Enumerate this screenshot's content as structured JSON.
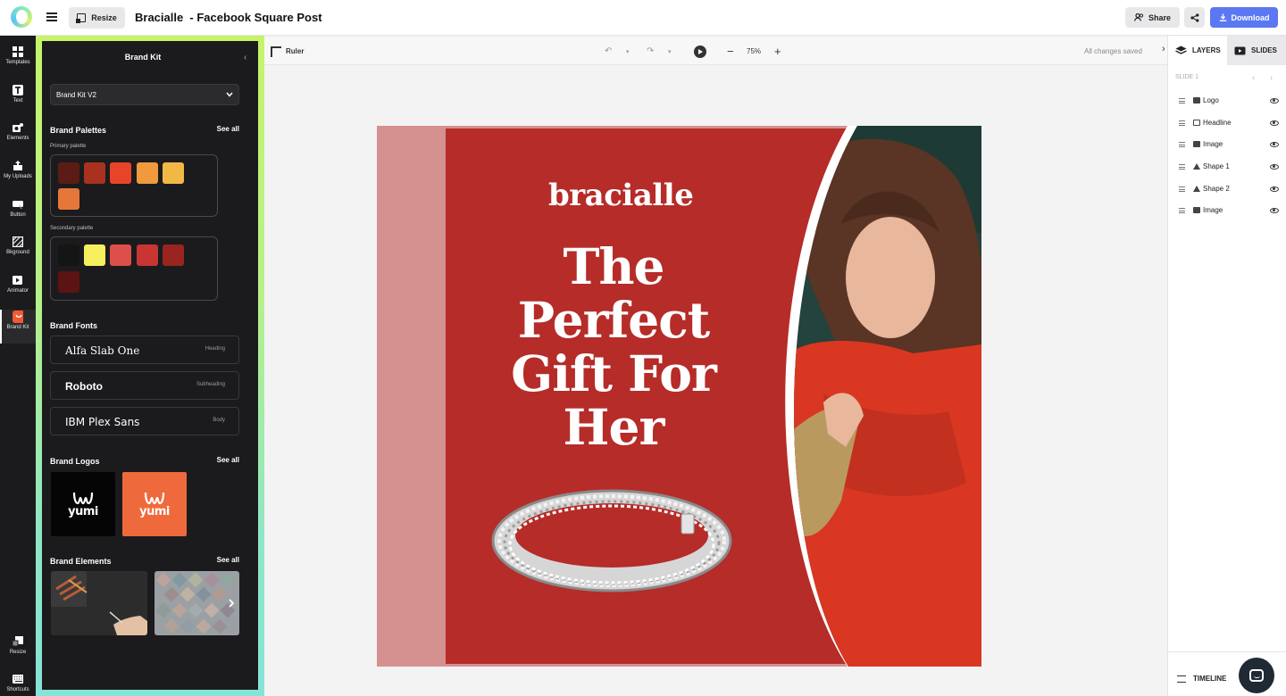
{
  "header": {
    "resize_label": "Resize",
    "title": "Bracialle  - Facebook Square Post",
    "share_label": "Share",
    "download_label": "Download"
  },
  "rail": {
    "items": [
      {
        "label": "Templates",
        "icon": "templates-icon"
      },
      {
        "label": "Text",
        "icon": "text-icon"
      },
      {
        "label": "Elements",
        "icon": "elements-icon"
      },
      {
        "label": "My Uploads",
        "icon": "uploads-icon"
      },
      {
        "label": "Button",
        "icon": "button-icon"
      },
      {
        "label": "Bkground",
        "icon": "background-icon"
      },
      {
        "label": "Animator",
        "icon": "animator-icon"
      },
      {
        "label": "Brand Kit",
        "icon": "brand-kit-icon"
      },
      {
        "label": "Resize",
        "icon": "resize-icon"
      },
      {
        "label": "Shortcuts",
        "icon": "keyboard-icon"
      }
    ]
  },
  "brand_kit": {
    "title": "Brand Kit",
    "selected_kit": "Brand Kit V2",
    "palettes_title": "Brand Palettes",
    "see_all": "See all",
    "primary_label": "Primary palette",
    "primary_colors": [
      "#5a1c14",
      "#a8321f",
      "#e8442a",
      "#ee9a3d",
      "#f2b845",
      "#e5773a"
    ],
    "secondary_label": "Secondary palette",
    "secondary_colors": [
      "#151515",
      "#f8ef5e",
      "#dd4f4a",
      "#c93532",
      "#9a2420",
      "#5c1412"
    ],
    "fonts_title": "Brand Fonts",
    "fonts": [
      {
        "name": "Alfa Slab One",
        "role": "Heading"
      },
      {
        "name": "Roboto",
        "role": "Subheading"
      },
      {
        "name": "IBM Plex Sans",
        "role": "Body"
      }
    ],
    "logos_title": "Brand Logos",
    "logos": [
      {
        "word": "yumi",
        "bg": "#050505"
      },
      {
        "word": "yumi",
        "bg": "#ee6a3c"
      }
    ],
    "elements_title": "Brand Elements"
  },
  "canvas_toolbar": {
    "ruler_label": "Ruler",
    "zoom": "75%",
    "saved_status": "All changes saved"
  },
  "artboard": {
    "brand_word": "bracialle",
    "headline": "The Perfect Gift For Her",
    "colors": {
      "frame": "#d59090",
      "panel": "#b52c28"
    }
  },
  "layers_panel": {
    "tab_layers": "LAYERS",
    "tab_slides": "SLIDES",
    "slide_label": "SLIDE 1",
    "layers": [
      "Logo",
      "Headline",
      "Image",
      "Shape 1",
      "Shape 2",
      "Image"
    ],
    "timeline_label": "TIMELINE"
  }
}
